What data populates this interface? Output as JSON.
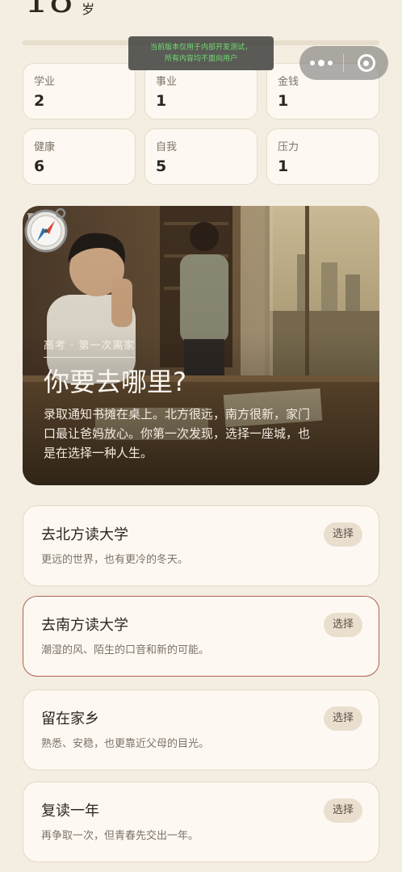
{
  "header": {
    "age": "18",
    "age_unit": "岁",
    "life_progress": 0.0
  },
  "dev_notice": {
    "line1": "当前版本仅用于内部开发测试，",
    "line2": "所有内容均不面向用户"
  },
  "capsule": {
    "more_icon": "more-dots-icon",
    "close_icon": "close-target-icon"
  },
  "stats": [
    {
      "label": "学业",
      "value": "2"
    },
    {
      "label": "事业",
      "value": "1"
    },
    {
      "label": "金钱",
      "value": "1"
    },
    {
      "label": "健康",
      "value": "6"
    },
    {
      "label": "自我",
      "value": "5"
    },
    {
      "label": "压力",
      "value": "1"
    }
  ],
  "scene": {
    "corner_text": "夏天",
    "tag": "高考 · 第一次离家",
    "title": "你要去哪里?",
    "body": "录取通知书摊在桌上。北方很远，南方很新，家门口最让爸妈放心。你第一次发现，选择一座城，也是在选择一种人生。",
    "icon": "compass-icon"
  },
  "choices": [
    {
      "title": "去北方读大学",
      "desc": "更远的世界，也有更冷的冬天。",
      "button": "选择",
      "selected": false
    },
    {
      "title": "去南方读大学",
      "desc": "潮湿的风、陌生的口音和新的可能。",
      "button": "选择",
      "selected": true
    },
    {
      "title": "留在家乡",
      "desc": "熟悉、安稳，也更靠近父母的目光。",
      "button": "选择",
      "selected": false
    },
    {
      "title": "复读一年",
      "desc": "再争取一次，但青春先交出一年。",
      "button": "选择",
      "selected": false
    }
  ],
  "colors": {
    "background": "#f4ede1",
    "card": "#fdf9f2",
    "selected_border": "#b0624f",
    "notice_text": "#6fdc6f"
  }
}
